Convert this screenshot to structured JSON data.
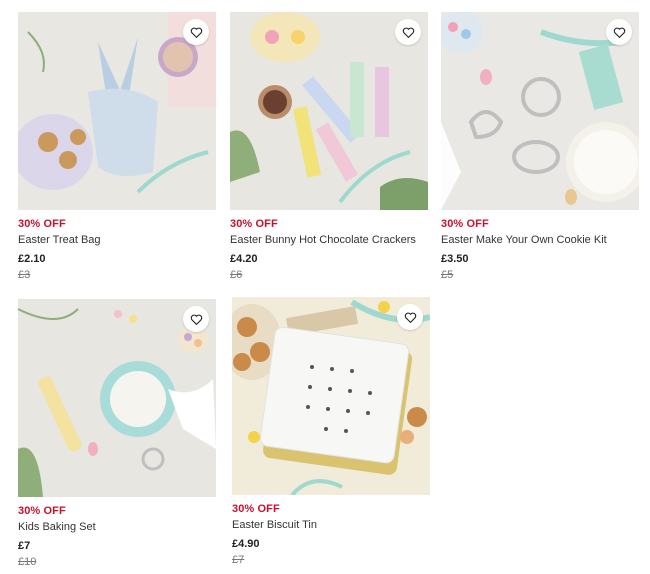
{
  "products": [
    {
      "discount": "30% OFF",
      "title": "Easter Treat Bag",
      "price": "£2.10",
      "was": "£3",
      "image_icon": "easter-treat-bag-image"
    },
    {
      "discount": "30% OFF",
      "title": "Easter Bunny Hot Chocolate Crackers",
      "price": "£4.20",
      "was": "£6",
      "image_icon": "hot-chocolate-crackers-image"
    },
    {
      "discount": "30% OFF",
      "title": "Easter Make Your Own Cookie Kit",
      "price": "£3.50",
      "was": "£5",
      "image_icon": "cookie-kit-image"
    },
    {
      "discount": "30% OFF",
      "title": "Kids Baking Set",
      "price": "£7",
      "was": "£10",
      "image_icon": "kids-baking-set-image"
    },
    {
      "discount": "30% OFF",
      "title": "Easter Biscuit Tin",
      "price": "£4.90",
      "was": "£7",
      "image_icon": "biscuit-tin-image"
    }
  ],
  "favourite_icon": "heart-outline-icon",
  "colors": {
    "discount": "#c8102e",
    "accent_ribbon": "#9fd8cf"
  }
}
